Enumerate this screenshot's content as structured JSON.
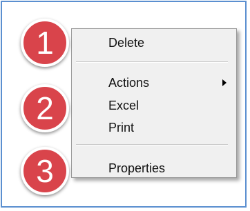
{
  "menu": {
    "items": [
      {
        "label": "Delete"
      },
      {
        "label": "Actions",
        "has_submenu": true
      },
      {
        "label": "Excel"
      },
      {
        "label": "Print"
      },
      {
        "label": "Properties"
      }
    ]
  },
  "badges": [
    "1",
    "2",
    "3"
  ],
  "colors": {
    "frame_border": "#5b8fd0",
    "menu_bg": "#f0f0f0",
    "badge": "#d9444b"
  },
  "icons": {
    "submenu_arrow": "chevron-right-icon"
  }
}
